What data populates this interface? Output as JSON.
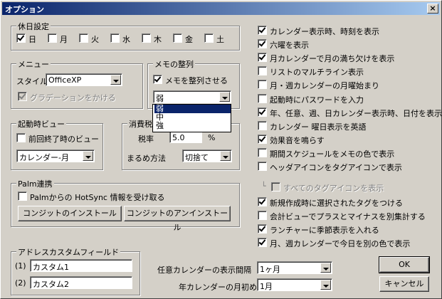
{
  "window": {
    "title": "オプション",
    "close_glyph": "×"
  },
  "holidays": {
    "label": "休日設定",
    "days": [
      {
        "label": "日",
        "checked": true
      },
      {
        "label": "月",
        "checked": false
      },
      {
        "label": "火",
        "checked": false
      },
      {
        "label": "水",
        "checked": false
      },
      {
        "label": "木",
        "checked": false
      },
      {
        "label": "金",
        "checked": false
      },
      {
        "label": "土",
        "checked": false
      }
    ]
  },
  "menu": {
    "label": "メニュー",
    "style_label": "スタイル",
    "style_value": "OfficeXP",
    "gradient_label": "グラデーションをかける",
    "gradient_checked": true
  },
  "memo_align": {
    "label": "メモの整列",
    "align_label": "メモを整列させる",
    "align_checked": true,
    "strength_value": "弱",
    "options": [
      "弱",
      "中",
      "強"
    ],
    "selected_option": "弱"
  },
  "startup_view": {
    "label": "起動時ビュー",
    "prev_label": "前回終了時のビュー",
    "prev_checked": false,
    "view_value": "カレンダー-月"
  },
  "tax": {
    "label": "消費税",
    "rate_label": "税率",
    "rate_value": "5.0",
    "rate_unit": "%",
    "round_label": "まるめ方法",
    "round_value": "切捨て"
  },
  "palm": {
    "label": "Palm連携",
    "hotsync_label": "Palmからの HotSync 情報を受け取る",
    "hotsync_checked": false,
    "install_label": "コンジットのインストール",
    "uninstall_label": "コンジットのアンインストール"
  },
  "address": {
    "label": "アドレスカスタムフィールド",
    "fields": [
      {
        "num": "(1)",
        "value": "カスタム1"
      },
      {
        "num": "(2)",
        "value": "カスタム2"
      }
    ]
  },
  "options": [
    {
      "label": "カレンダー表示時、時刻を表示",
      "checked": true
    },
    {
      "label": "六曜を表示",
      "checked": true
    },
    {
      "label": "月カレンダーで月の満ち欠けを表示",
      "checked": true
    },
    {
      "label": "リストのマルチライン表示",
      "checked": false
    },
    {
      "label": "月・週カレンダーの月曜始まり",
      "checked": false
    },
    {
      "label": "起動時にパスワードを入力",
      "checked": false
    },
    {
      "label": "年、任意、週、日カレンダー表示時、日付を表示",
      "checked": true
    },
    {
      "label": "カレンダー 曜日表示を英語",
      "checked": false
    },
    {
      "label": "効果音を鳴らす",
      "checked": true
    },
    {
      "label": "期間スケジュールをメモの色で表示",
      "checked": false
    },
    {
      "label": "ヘッダアイコンをタグアイコンで表示",
      "checked": false
    }
  ],
  "sub_option": {
    "label": "すべてのタグアイコンを表示",
    "checked": false,
    "tree_glyph": "└"
  },
  "options2": [
    {
      "label": "新規作成時に選択されたタグをつける",
      "checked": true
    },
    {
      "label": "会計ビューでプラスとマイナスを別集計する",
      "checked": false
    },
    {
      "label": "ランチャーに季節表示を入れる",
      "checked": true
    },
    {
      "label": "月、週カレンダーで今日を別の色で表示",
      "checked": true
    }
  ],
  "bottom": {
    "interval_label": "任意カレンダーの表示間隔",
    "interval_value": "1ヶ月",
    "month_start_label": "年カレンダーの月初め",
    "month_start_value": "1月",
    "ok_label": "OK",
    "cancel_label": "キャンセル"
  }
}
